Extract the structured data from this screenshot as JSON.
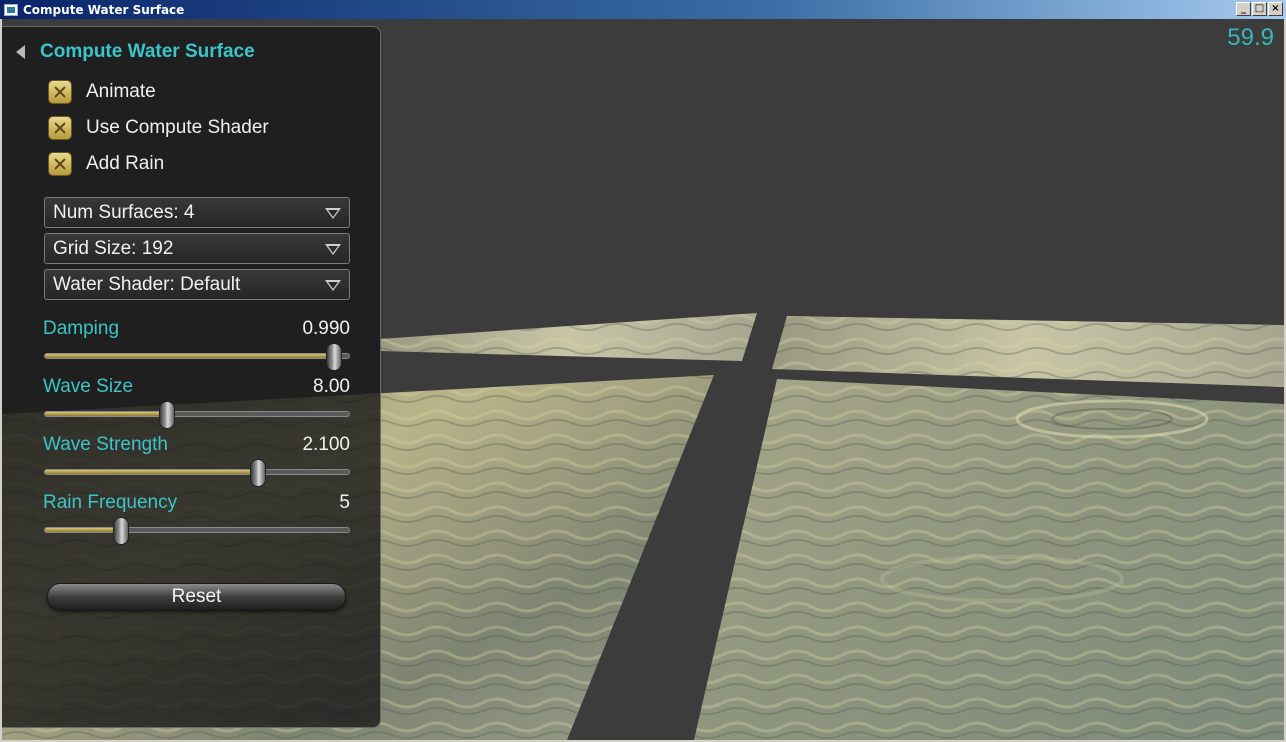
{
  "window": {
    "title": "Compute Water Surface",
    "buttons": {
      "minimize": "_",
      "maximize": "□",
      "close": "×"
    }
  },
  "fps": "59.9",
  "panel": {
    "title": "Compute Water Surface",
    "checkboxes": [
      {
        "label": "Animate",
        "checked": true
      },
      {
        "label": "Use Compute Shader",
        "checked": true
      },
      {
        "label": "Add Rain",
        "checked": true
      }
    ],
    "dropdowns": [
      {
        "label": "Num Surfaces: 4"
      },
      {
        "label": "Grid Size: 192"
      },
      {
        "label": "Water Shader: Default"
      }
    ],
    "sliders": [
      {
        "label": "Damping",
        "value": "0.990",
        "fraction": 0.95
      },
      {
        "label": "Wave Size",
        "value": "8.00",
        "fraction": 0.4
      },
      {
        "label": "Wave Strength",
        "value": "2.100",
        "fraction": 0.7
      },
      {
        "label": "Rain Frequency",
        "value": "5",
        "fraction": 0.25
      }
    ],
    "reset_label": "Reset"
  },
  "colors": {
    "accent": "#3cc4c8",
    "background": "#3c3c3c",
    "checkbox": "#d8c47a"
  }
}
